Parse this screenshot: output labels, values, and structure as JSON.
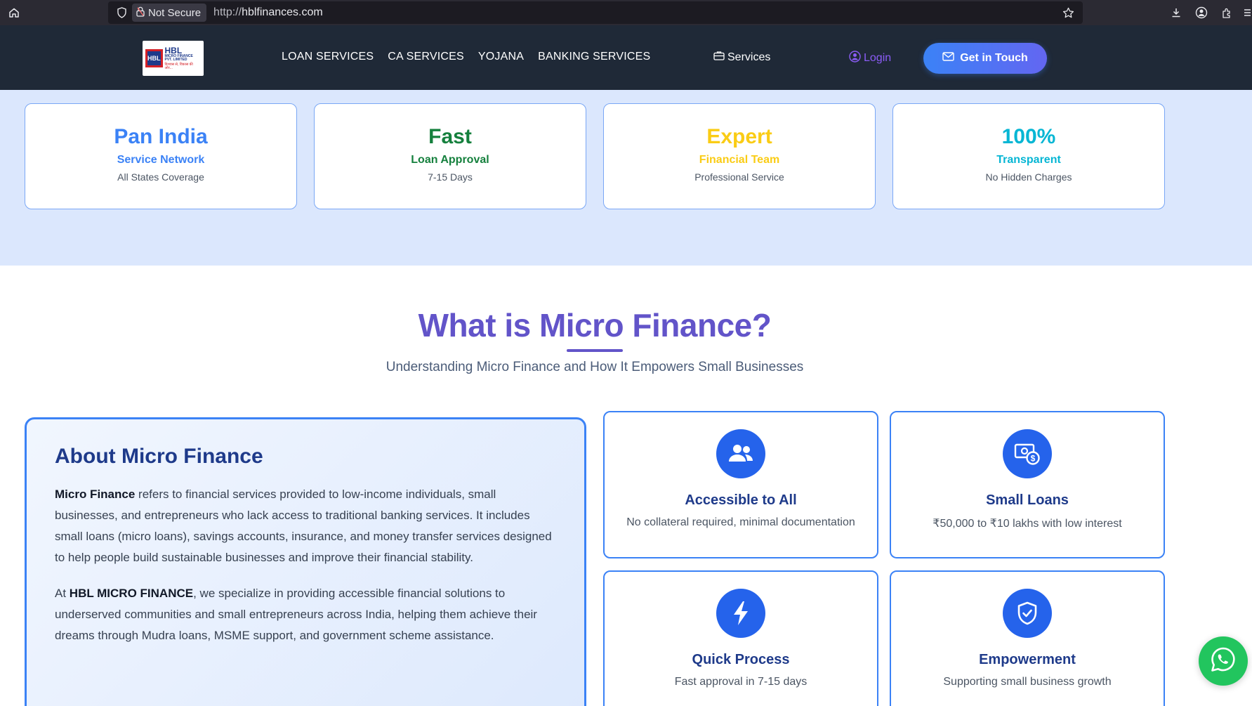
{
  "browser": {
    "security_label": "Not Secure",
    "url_prefix": "http://",
    "url_domain": "hblfinances.com"
  },
  "navbar": {
    "logo": {
      "mark": "HBL",
      "name": "HBL",
      "subtitle": "MICRO FINANCE PVT. LIMITED",
      "tagline": "विश्वास से, विकास की ओर..."
    },
    "links": [
      "LOAN SERVICES",
      "CA SERVICES",
      "YOJANA",
      "BANKING SERVICES"
    ],
    "services_label": "Services",
    "login_label": "Login",
    "cta_label": "Get in Touch"
  },
  "stats": [
    {
      "big": "Pan India",
      "mid": "Service Network",
      "small": "All States Coverage",
      "color": "#3b82f6"
    },
    {
      "big": "Fast",
      "mid": "Loan Approval",
      "small": "7-15 Days",
      "color": "#15803d"
    },
    {
      "big": "Expert",
      "mid": "Financial Team",
      "small": "Professional Service",
      "color": "#facc15"
    },
    {
      "big": "100%",
      "mid": "Transparent",
      "small": "No Hidden Charges",
      "color": "#06b6d4"
    }
  ],
  "section": {
    "title": "What is Micro Finance?",
    "subtitle": "Understanding Micro Finance and How It Empowers Small Businesses"
  },
  "about": {
    "title": "About Micro Finance",
    "p1_bold": "Micro Finance",
    "p1_rest": " refers to financial services provided to low-income individuals, small businesses, and entrepreneurs who lack access to traditional banking services. It includes small loans (micro loans), savings accounts, insurance, and money transfer services designed to help people build sustainable businesses and improve their financial stability.",
    "p2_start": "At ",
    "p2_bold": "HBL MICRO FINANCE",
    "p2_rest": ", we specialize in providing accessible financial solutions to underserved communities and small entrepreneurs across India, helping them achieve their dreams through Mudra loans, MSME support, and government scheme assistance."
  },
  "features": [
    {
      "icon": "users-icon",
      "title": "Accessible to All",
      "desc": "No collateral required, minimal documentation"
    },
    {
      "icon": "money-icon",
      "title": "Small Loans",
      "desc": "₹50,000 to ₹10 lakhs with low interest"
    },
    {
      "icon": "bolt-icon",
      "title": "Quick Process",
      "desc": "Fast approval in 7-15 days"
    },
    {
      "icon": "shield-check-icon",
      "title": "Empowerment",
      "desc": "Supporting small business growth"
    }
  ],
  "colors": {
    "accent": "#3b82f6",
    "title_purple": "#6254c9",
    "navy": "#1e3a8a",
    "nav_bg": "#1f2937",
    "whatsapp": "#22c55e"
  }
}
